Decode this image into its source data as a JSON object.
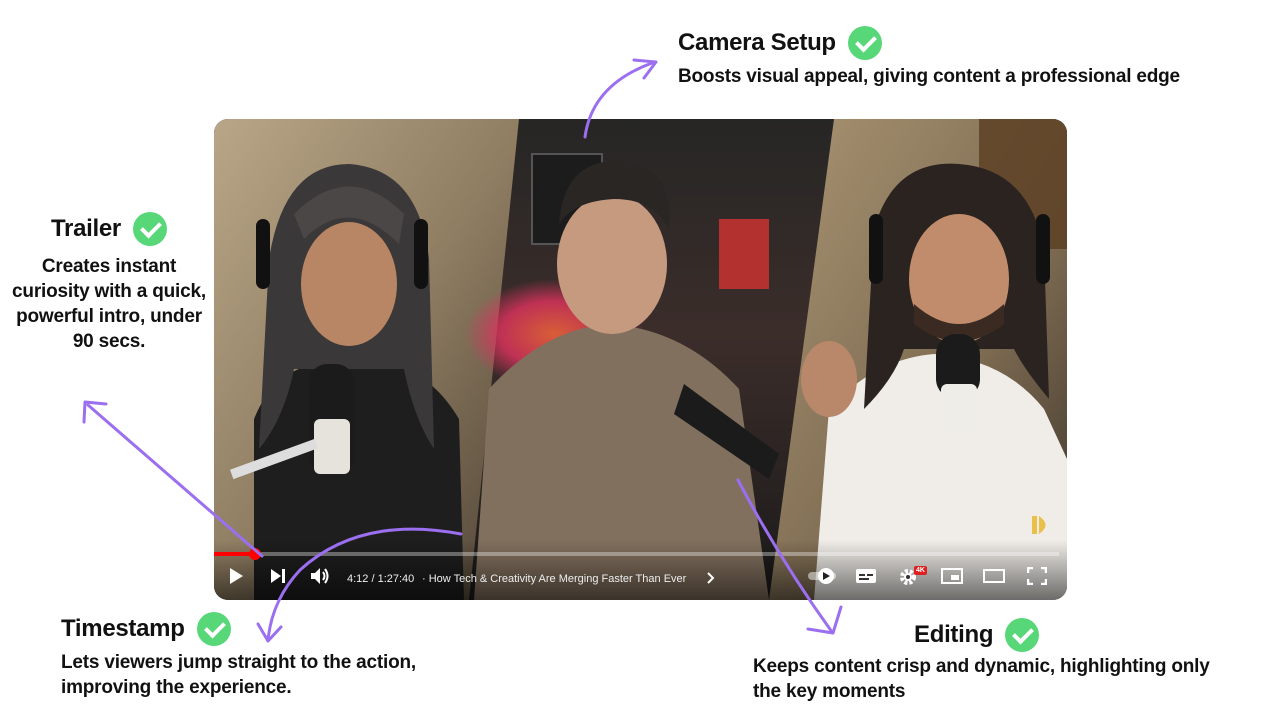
{
  "annotations": {
    "camera_setup": {
      "title": "Camera Setup",
      "text": "Boosts visual appeal, giving content a professional edge"
    },
    "trailer": {
      "title": "Trailer",
      "text": "Creates instant curiosity with a quick, powerful intro, under 90 secs."
    },
    "timestamp": {
      "title": "Timestamp",
      "text": "Lets viewers jump straight to the action, improving the experience."
    },
    "editing": {
      "title": "Editing",
      "text": "Keeps content crisp and dynamic, highlighting only the key moments"
    }
  },
  "player": {
    "time": "4:12 / 1:27:40",
    "chapter": "· How Tech & Creativity Are Merging Faster Than Ever",
    "progress_fraction": 0.048,
    "quality_badge": "4K",
    "watermark_icon": "channel-logo-icon",
    "icons": [
      "play-icon",
      "next-icon",
      "volume-icon",
      "chevron-right-icon",
      "autoplay-icon",
      "subtitles-icon",
      "settings-icon",
      "miniplayer-icon",
      "theater-mode-icon",
      "fullscreen-icon"
    ]
  },
  "colors": {
    "check_green": "#57d777",
    "arrow_purple": "#9b6ff0",
    "progress_red": "#ff0000"
  }
}
